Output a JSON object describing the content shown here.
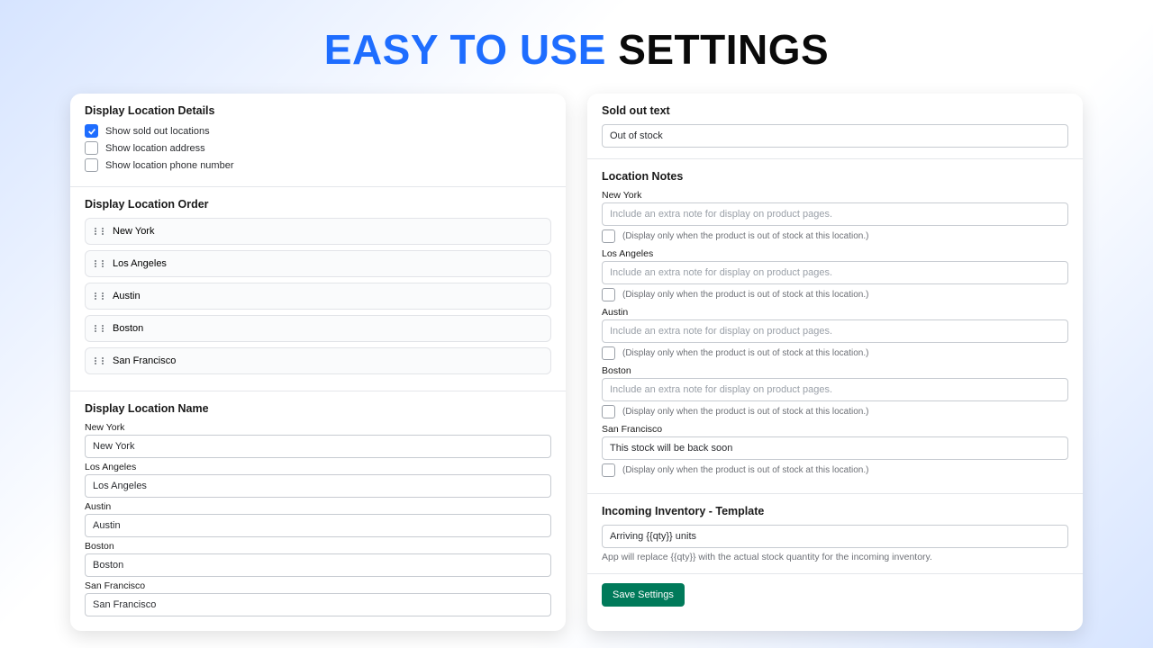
{
  "title": {
    "part1": "EASY TO USE",
    "part2": "SETTINGS"
  },
  "details": {
    "heading": "Display Location Details",
    "opts": [
      {
        "label": "Show sold out locations",
        "checked": true
      },
      {
        "label": "Show location address",
        "checked": false
      },
      {
        "label": "Show location phone number",
        "checked": false
      }
    ]
  },
  "order": {
    "heading": "Display Location Order",
    "items": [
      "New York",
      "Los Angeles",
      "Austin",
      "Boston",
      "San Francisco"
    ]
  },
  "name": {
    "heading": "Display Location Name",
    "items": [
      {
        "label": "New York",
        "value": "New York"
      },
      {
        "label": "Los Angeles",
        "value": "Los Angeles"
      },
      {
        "label": "Austin",
        "value": "Austin"
      },
      {
        "label": "Boston",
        "value": "Boston"
      },
      {
        "label": "San Francisco",
        "value": "San Francisco"
      }
    ]
  },
  "soldout": {
    "heading": "Sold out text",
    "value": "Out of stock"
  },
  "notes": {
    "heading": "Location Notes",
    "placeholder": "Include an extra note for display on product pages.",
    "check_hint": "(Display only when the product is out of stock at this location.)",
    "items": [
      {
        "label": "New York",
        "value": ""
      },
      {
        "label": "Los Angeles",
        "value": ""
      },
      {
        "label": "Austin",
        "value": ""
      },
      {
        "label": "Boston",
        "value": ""
      },
      {
        "label": "San Francisco",
        "value": "This stock will be back soon"
      }
    ]
  },
  "incoming": {
    "heading": "Incoming Inventory - Template",
    "value": "Arriving {{qty}} units",
    "helper": "App will replace {{qty}} with the actual stock quantity for the incoming inventory."
  },
  "save_label": "Save Settings"
}
